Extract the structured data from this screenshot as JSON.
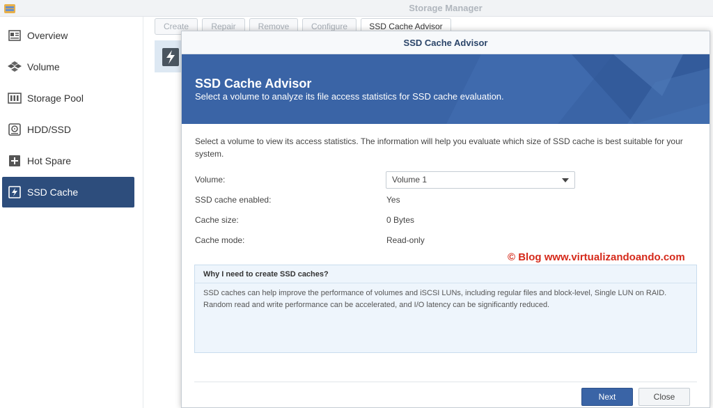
{
  "app": {
    "title": "Storage Manager"
  },
  "sidebar": {
    "items": [
      {
        "label": "Overview",
        "icon": "overview-icon"
      },
      {
        "label": "Volume",
        "icon": "volume-icon"
      },
      {
        "label": "Storage Pool",
        "icon": "storage-pool-icon"
      },
      {
        "label": "HDD/SSD",
        "icon": "hdd-icon"
      },
      {
        "label": "Hot Spare",
        "icon": "hot-spare-icon"
      },
      {
        "label": "SSD Cache",
        "icon": "ssd-cache-icon",
        "active": true
      }
    ]
  },
  "toolbar": {
    "create": "Create",
    "repair": "Repair",
    "remove": "Remove",
    "configure": "Configure",
    "advisor": "SSD Cache Advisor"
  },
  "dialog": {
    "title": "SSD Cache Advisor",
    "hero_title": "SSD Cache Advisor",
    "hero_subtitle": "Select a volume to analyze its file access statistics for SSD cache evaluation.",
    "description": "Select a volume to view its access statistics. The information will help you evaluate which size of SSD cache is best suitable for your system.",
    "fields": {
      "volume_label": "Volume:",
      "volume_value": "Volume 1",
      "enabled_label": "SSD cache enabled:",
      "enabled_value": "Yes",
      "size_label": "Cache size:",
      "size_value": "0 Bytes",
      "mode_label": "Cache mode:",
      "mode_value": "Read-only"
    },
    "info": {
      "heading": "Why I need to create SSD caches?",
      "body": "SSD caches can help improve the performance of volumes and iSCSI LUNs, including regular files and block-level, Single LUN on RAID. Random read and write performance can be accelerated, and I/O latency can be significantly reduced."
    },
    "buttons": {
      "next": "Next",
      "close": "Close"
    }
  },
  "watermark": "© Blog www.virtualizandoando.com",
  "colors": {
    "accent": "#3a64a6",
    "sidebar_active": "#2d4d7c",
    "watermark": "#d52a1b"
  }
}
